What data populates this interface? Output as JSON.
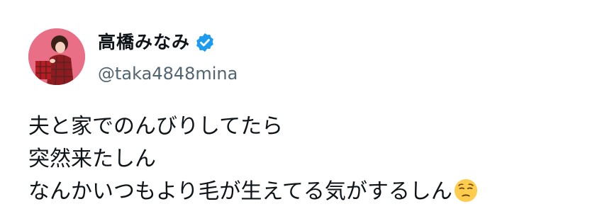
{
  "author": {
    "display_name": "高橋みなみ",
    "handle": "@taka4848mina",
    "verified": true,
    "avatar_icon": "profile-photo",
    "verified_icon": "verified-badge-icon"
  },
  "tweet": {
    "lines": [
      "夫と家でのんびりしてたら",
      "突然来たしん",
      "なんかいつもより毛が生えてる気がするしん"
    ],
    "trailing_emoji": "pensive-face-emoji"
  },
  "colors": {
    "text": "#0f1419",
    "secondary_text": "#536471",
    "verified_blue": "#1d9bf0",
    "avatar_bg": "#e96f86",
    "emoji_yellow": "#ffcc4d"
  }
}
